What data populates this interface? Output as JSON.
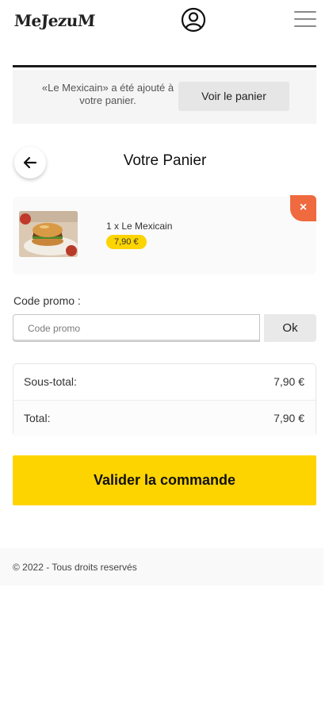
{
  "header": {
    "logo_text": "MeJezuM",
    "user_icon": "user-circle-icon",
    "menu_icon": "hamburger-menu-icon"
  },
  "notice": {
    "message": "«Le Mexicain» a été ajouté à votre panier.",
    "cart_button": "Voir le panier"
  },
  "page": {
    "title": "Votre Panier",
    "back_icon": "arrow-left-icon"
  },
  "cart": {
    "items": [
      {
        "label": "1 x Le Mexicain",
        "price": "7,90 €",
        "remove_label": "×"
      }
    ]
  },
  "promo": {
    "label": "Code promo :",
    "placeholder": "Code promo",
    "value": "",
    "submit": "Ok"
  },
  "totals": {
    "rows": [
      {
        "label": "Sous-total:",
        "value": "7,90 €"
      },
      {
        "label": "Total:",
        "value": "7,90 €"
      }
    ]
  },
  "checkout": {
    "button": "Valider la commande"
  },
  "footer": {
    "copyright": "© 2022 - Tous droits reservés"
  },
  "colors": {
    "accent": "#fdd400",
    "remove": "#ef6a3f"
  }
}
